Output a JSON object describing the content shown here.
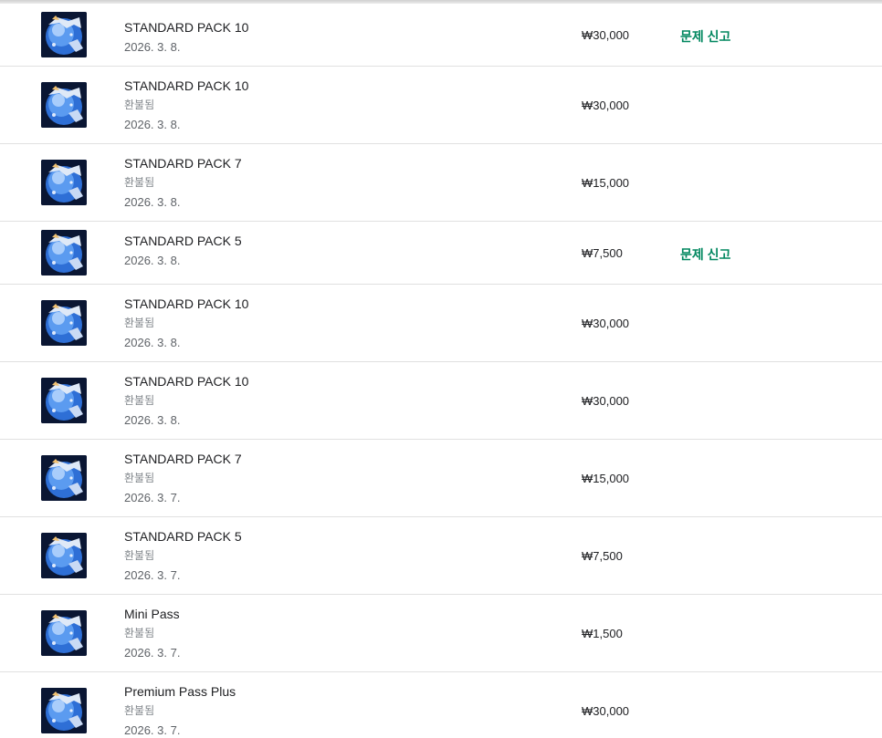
{
  "purchases": [
    {
      "title": "STANDARD PACK 10",
      "status": "",
      "date": "2026. 3. 8.",
      "price": "₩30,000",
      "action": "문제 신고"
    },
    {
      "title": "STANDARD PACK 10",
      "status": "환불됨",
      "date": "2026. 3. 8.",
      "price": "₩30,000",
      "action": ""
    },
    {
      "title": "STANDARD PACK 7",
      "status": "환불됨",
      "date": "2026. 3. 8.",
      "price": "₩15,000",
      "action": ""
    },
    {
      "title": "STANDARD PACK 5",
      "status": "",
      "date": "2026. 3. 8.",
      "price": "₩7,500",
      "action": "문제 신고"
    },
    {
      "title": "STANDARD PACK 10",
      "status": "환불됨",
      "date": "2026. 3. 8.",
      "price": "₩30,000",
      "action": ""
    },
    {
      "title": "STANDARD PACK 10",
      "status": "환불됨",
      "date": "2026. 3. 8.",
      "price": "₩30,000",
      "action": ""
    },
    {
      "title": "STANDARD PACK 7",
      "status": "환불됨",
      "date": "2026. 3. 7.",
      "price": "₩15,000",
      "action": ""
    },
    {
      "title": "STANDARD PACK 5",
      "status": "환불됨",
      "date": "2026. 3. 7.",
      "price": "₩7,500",
      "action": ""
    },
    {
      "title": "Mini Pass",
      "status": "환불됨",
      "date": "2026. 3. 7.",
      "price": "₩1,500",
      "action": ""
    },
    {
      "title": "Premium Pass Plus",
      "status": "환불됨",
      "date": "2026. 3. 7.",
      "price": "₩30,000",
      "action": ""
    }
  ],
  "icons": {
    "thumbnail": "game-orb-thumbnail-icon"
  },
  "colors": {
    "action": "#01875f",
    "divider": "#e0e0e0",
    "muted": "#80868b"
  }
}
